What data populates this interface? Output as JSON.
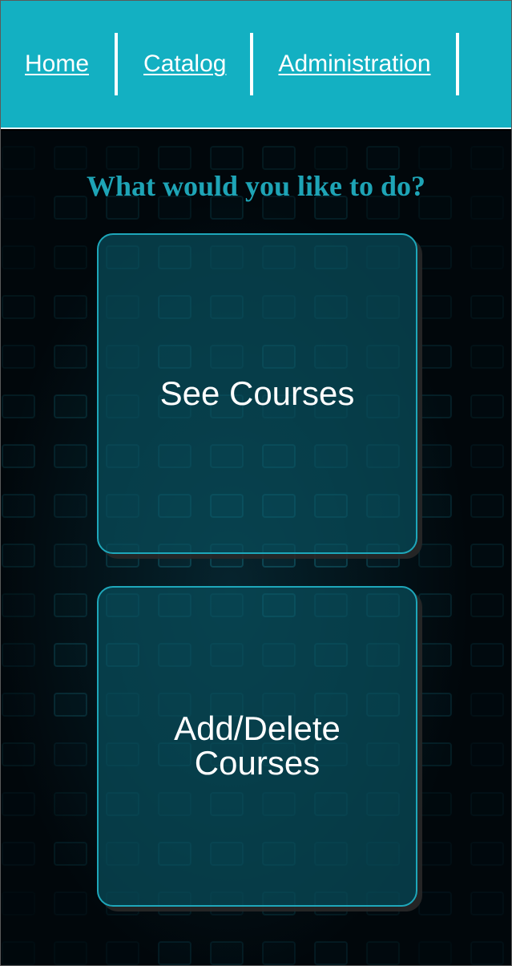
{
  "nav": {
    "items": [
      {
        "label": "Home"
      },
      {
        "label": "Catalog"
      },
      {
        "label": "Administration"
      }
    ]
  },
  "main": {
    "heading": "What would you like to do?",
    "actions": [
      {
        "label": "See Courses"
      },
      {
        "label": "Add/Delete Courses"
      }
    ]
  },
  "colors": {
    "navbar": "#13b0c2",
    "heading": "#1ea4b6",
    "card_border": "#1ea7ba",
    "card_fill": "#084e5c",
    "background": "#01070b"
  }
}
